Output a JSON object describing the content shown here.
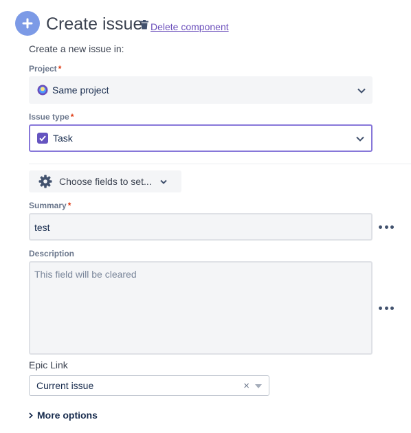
{
  "header": {
    "icon": "plus-icon",
    "title": "Create issue",
    "delete_icon": "trash-icon",
    "delete_label": "Delete component"
  },
  "intro": "Create a new issue in:",
  "project": {
    "label": "Project",
    "required": "*",
    "icon": "project-avatar-icon",
    "value": "Same project"
  },
  "issue_type": {
    "label": "Issue type",
    "required": "*",
    "icon": "task-checkbox-icon",
    "value": "Task"
  },
  "choose_fields": {
    "icon": "gear-icon",
    "label": "Choose fields to set..."
  },
  "summary": {
    "label": "Summary",
    "required": "*",
    "value": "test"
  },
  "description": {
    "label": "Description",
    "placeholder": "This field will be cleared"
  },
  "epic_link": {
    "label": "Epic Link",
    "value": "Current issue",
    "clear": "×"
  },
  "more_options": {
    "label": "More options"
  },
  "colors": {
    "accent": "#7c9ae6",
    "link": "#6b4fbb",
    "focus_border": "#8777d9",
    "required": "#de350b",
    "task": "#6554c0"
  }
}
